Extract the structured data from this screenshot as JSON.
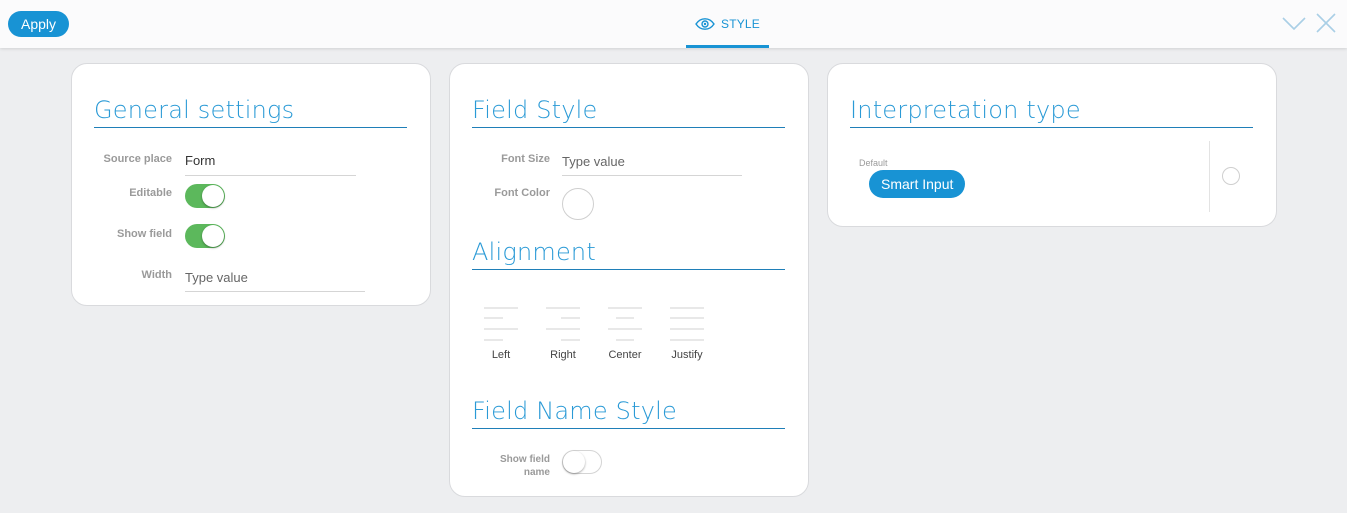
{
  "toolbar": {
    "apply_label": "Apply",
    "tab_label": "STYLE",
    "tab_icon": "eye-icon",
    "accent_color": "#1893d4"
  },
  "general": {
    "title": "General settings",
    "source_place_label": "Source place",
    "source_place_value": "Form",
    "editable_label": "Editable",
    "editable_on": true,
    "show_field_label": "Show field",
    "show_field_on": true,
    "width_label": "Width",
    "width_placeholder": "Type value"
  },
  "field_style": {
    "title": "Field Style",
    "font_size_label": "Font Size",
    "font_size_placeholder": "Type value",
    "font_color_label": "Font Color"
  },
  "alignment": {
    "title": "Alignment",
    "options": [
      {
        "label": "Left"
      },
      {
        "label": "Right"
      },
      {
        "label": "Center"
      },
      {
        "label": "Justify"
      }
    ]
  },
  "field_name_style": {
    "title": "Field Name Style",
    "show_field_name_label_1": "Show field",
    "show_field_name_label_2": "name",
    "show_field_name_on": false
  },
  "interpretation": {
    "title": "Interpretation type",
    "default_label": "Default",
    "chip_label": "Smart Input"
  }
}
